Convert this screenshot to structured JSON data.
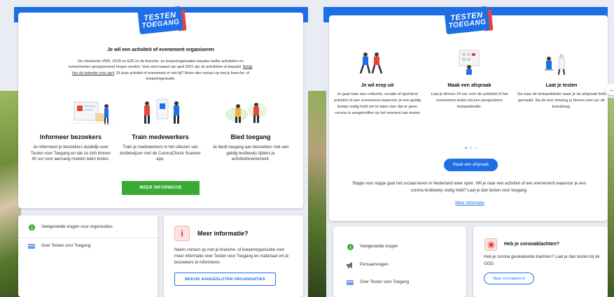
{
  "logo": {
    "line1": "TESTEN",
    "line2": "TOEGANG"
  },
  "left": {
    "title": "Je wil een activiteit of evenement organiseren",
    "intro_before": "De ministeries VWS, OCW en EZK en de branche- en koepelorganisaties bepalen welke activiteiten en evenementen georganiseerd mogen worden. Voor eind maand van april 2021 zijn de activiteiten al bepaald.",
    "intro_link": "Bekijk hier de kalender voor april",
    "intro_after": ". Zit jouw activiteit of evenement er niet bij? Neem dan contact op met je branche- of koepelorganisatie.",
    "columns": [
      {
        "title": "Informeer bezoekers",
        "text": "Je informeert je bezoekers duidelijk over Testen voor Toegang en dat ze zich binnen 40 uur voor aanvang moeten laten testen."
      },
      {
        "title": "Train medewerkers",
        "text": "Train je medewerkers in het uitlezen van testbewijzen met de CoronaCheck Scanner app."
      },
      {
        "title": "Bied toegang",
        "text": "Je biedt toegang aan bezoekers met een geldig testbewijs tijdens je activiteit/evenement."
      }
    ],
    "cta_label": "MEER INFORMATIE",
    "faq": [
      {
        "label": "Veelgestelde vragen voor organisaties",
        "icon": "info-circle-icon"
      },
      {
        "label": "Over Testen voor Toegang",
        "icon": "card-icon"
      }
    ],
    "info": {
      "icon_glyph": "i",
      "title": "Meer informatie?",
      "text": "Neem contact op met je branche- of koepelorganisatie voor meer informatie over Testen voor Toegang en materiaal om je bezoekers te informeren.",
      "button_label": "BEKIJK AANGESLOTEN ORGANISATIES"
    }
  },
  "right": {
    "columns": [
      {
        "title": "Je wil erop uit",
        "text": "Je gaat naar een culturele, sociale of sportieve activiteit of een evenement waarvoor je een geldig bewijs nodig hebt om te laten zien dat er geen corona is aangetroffen op het moment van testen"
      },
      {
        "title": "Maak een afspraak",
        "text": "Laat je binnen 24 uur voor de activiteit of het evenement testen bij een aangesloten testaanbieder."
      },
      {
        "title": "Laat je testen",
        "text": "Ga naar de testaanbieder waar je de afspraak hebt gemaakt. Na de test ontvang je binnen een uur de testuitslag."
      }
    ],
    "cta_label": "Maak een afspraak",
    "tagline": "Stapje voor stapje gaat het sociaal leven in Nederland weer open. Wil je naar een activiteit of een evenement waarvoor je een corona testbewijs nodig hebt? Laat je dan testen voor toegang.",
    "link_label": "Meer informatie",
    "arrow_glyph": "→",
    "faq": [
      {
        "label": "Veelgestelde vragen",
        "icon": "info-circle-icon"
      },
      {
        "label": "Persaanvragen",
        "icon": "megaphone-icon"
      },
      {
        "label": "Over Testen voor Toegang",
        "icon": "card-icon"
      }
    ],
    "info": {
      "title": "Heb je coronaklachten?",
      "text": "Heb je corona gerelateerde klachten? Laat je dan testen bij de GGD.",
      "button_label": "Naar coronatest.nl"
    }
  },
  "colors": {
    "brand_blue": "#1e6ee6",
    "green": "#3aaa35",
    "red": "#e8433a"
  }
}
